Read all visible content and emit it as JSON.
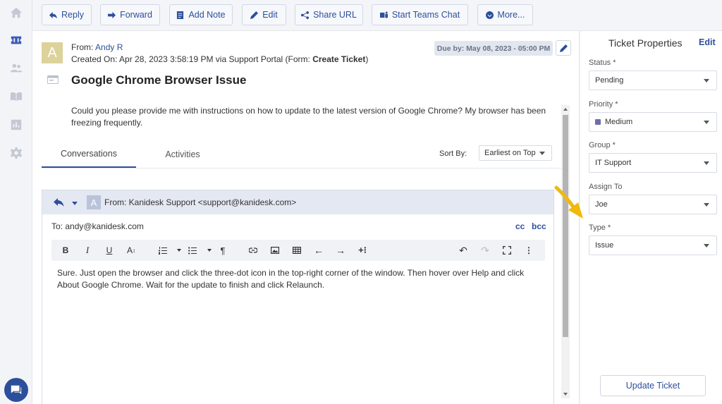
{
  "nav": {
    "items": [
      {
        "name": "home-icon",
        "active": false
      },
      {
        "name": "tickets-icon",
        "active": true
      },
      {
        "name": "contacts-icon",
        "active": false
      },
      {
        "name": "knowledge-base-icon",
        "active": false
      },
      {
        "name": "reports-icon",
        "active": false
      },
      {
        "name": "settings-icon",
        "active": false
      }
    ]
  },
  "toolbar": {
    "reply": "Reply",
    "forward": "Forward",
    "add_note": "Add Note",
    "edit": "Edit",
    "share_url": "Share URL",
    "teams_chat": "Start Teams Chat",
    "more": "More..."
  },
  "ticket": {
    "avatar_letter": "A",
    "from_prefix": "From: ",
    "from_name": "Andy R",
    "created_prefix": "Created On: Apr 28, 2023 3:58:19 PM via Support Portal (Form: ",
    "created_form": "Create Ticket",
    "created_suffix": ")",
    "due": "Due by: May 08, 2023 - 05:00 PM",
    "subject": "Google Chrome Browser Issue",
    "description": "Could you please provide me with instructions on how to update to the latest version of Google Chrome? My browser has been freezing frequently."
  },
  "tabs": {
    "conversations": "Conversations",
    "activities": "Activities",
    "sort_label": "Sort By:",
    "sort_value": "Earliest on Top"
  },
  "reply": {
    "avatar_letter": "A",
    "from": "From: Kanidesk Support <support@kanidesk.com>",
    "to": "To: andy@kanidesk.com",
    "cc": "cc",
    "bcc": "bcc",
    "body": "Sure. Just open the browser and click the three-dot icon in the top-right corner of the window. Then hover over Help and click About Google Chrome. Wait for the update to finish and click Relaunch."
  },
  "properties": {
    "title": "Ticket Properties",
    "edit": "Edit",
    "status_label": "Status",
    "status_value": "Pending",
    "priority_label": "Priority",
    "priority_value": "Medium",
    "group_label": "Group",
    "group_value": "IT Support",
    "assign_label": "Assign To",
    "assign_value": "Joe",
    "type_label": "Type",
    "type_value": "Issue",
    "required_mark": "*",
    "update_button": "Update Ticket"
  },
  "colors": {
    "accent": "#2c4f9c",
    "pointer_arrow": "#f0b90b",
    "priority_medium": "#6c6fa8"
  }
}
